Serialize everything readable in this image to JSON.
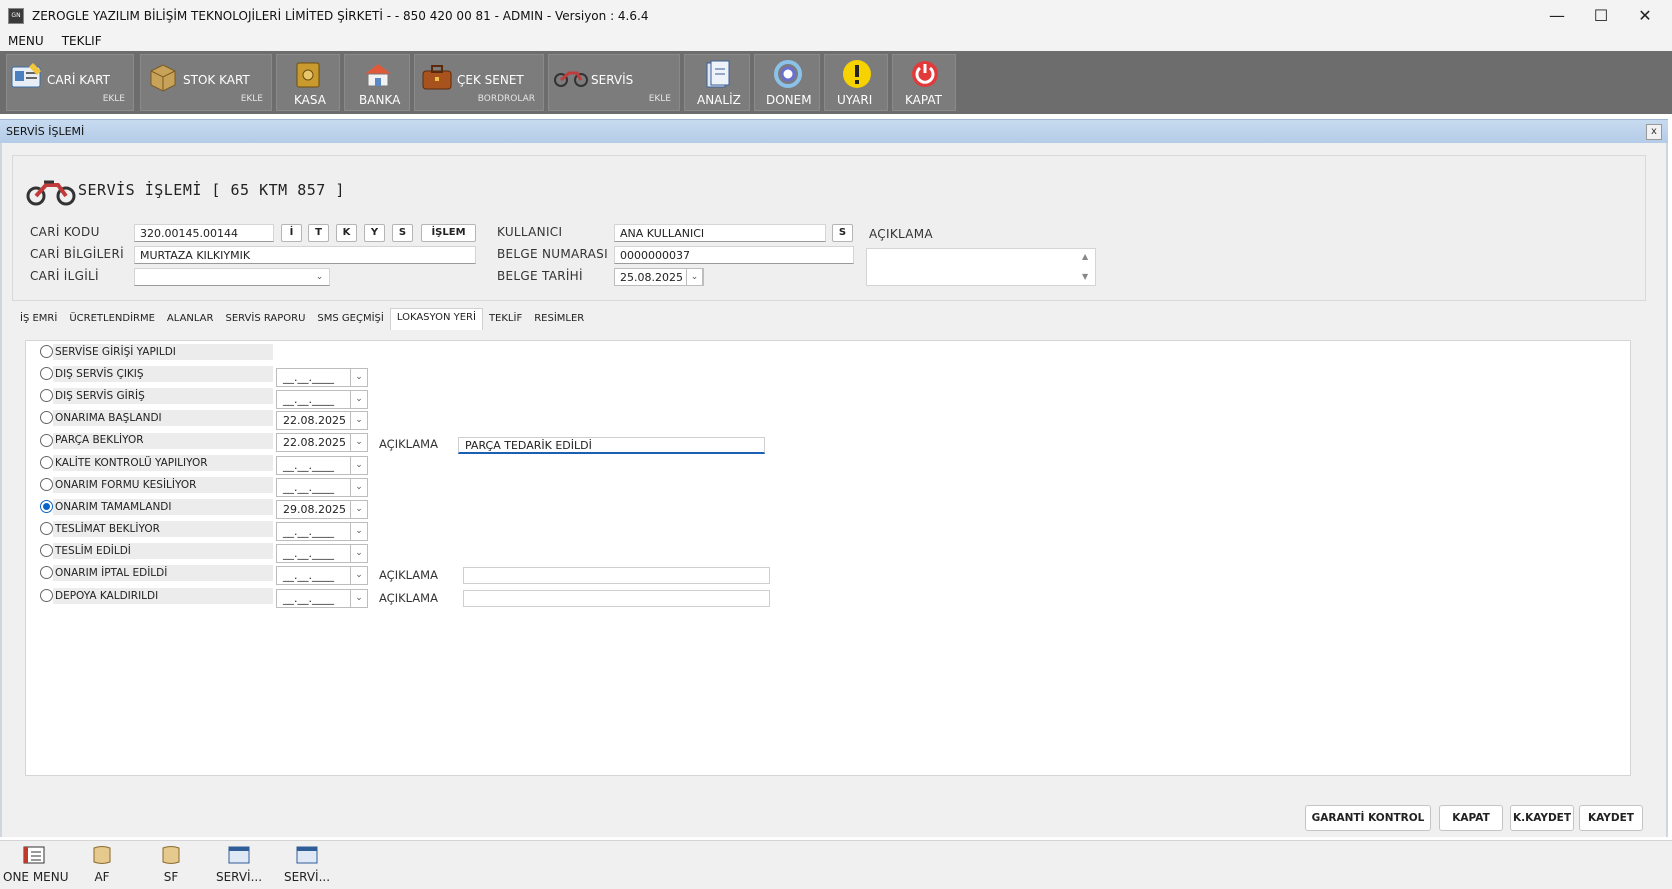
{
  "window": {
    "title": "ZEROGLE YAZILIM BİLİŞİM TEKNOLOJİLERİ LİMİTED ŞİRKETİ -  - 850 420 00 81 - ADMIN -  Versiyon : 4.6.4",
    "minimize": "—",
    "maximize": "☐",
    "close": "✕"
  },
  "menu": [
    "MENU",
    "TEKLIF"
  ],
  "toolbar": {
    "cari_kart": "CARİ KART",
    "cari_kart_sub": "EKLE",
    "stok_kart": "STOK KART",
    "stok_kart_sub": "EKLE",
    "kasa": "KASA",
    "banka": "BANKA",
    "cek_senet": "ÇEK SENET",
    "cek_senet_sub": "BORDROLAR",
    "servis": "SERVİS",
    "servis_sub": "EKLE",
    "analiz": "ANALİZ",
    "donem": "DONEM",
    "uyari": "UYARI",
    "kapat": "KAPAT"
  },
  "dialog": {
    "title": "SERVİS İŞLEMİ",
    "close": "x",
    "heading": "SERVİS İŞLEMİ [ 65 KTM 857 ]"
  },
  "form": {
    "cari_kodu_label": "CARİ KODU",
    "cari_kodu": "320.00145.00144",
    "btn_i": "İ",
    "btn_t": "T",
    "btn_k": "K",
    "btn_y": "Y",
    "btn_s": "S",
    "btn_islem": "İŞLEM",
    "cari_bilgileri_label": "CARİ BİLGİLERİ",
    "cari_bilgileri": "MURTAZA KILKIYMIK",
    "cari_ilgili_label": "CARİ İLGİLİ",
    "cari_ilgili": "",
    "kullanici_label": "KULLANICI",
    "kullanici": "ANA KULLANICI",
    "kullanici_btn": "S",
    "belge_no_label": "BELGE NUMARASI",
    "belge_no": "0000000037",
    "belge_tarihi_label": "BELGE TARİHİ",
    "belge_tarihi": "25.08.2025",
    "aciklama_label": "AÇIKLAMA",
    "aciklama": ""
  },
  "tabs": [
    "İŞ EMRİ",
    "ÜCRETLENDİRME",
    "ALANLAR",
    "SERVİS RAPORU",
    "SMS GEÇMİŞİ",
    "LOKASYON YERİ",
    "TEKLİF",
    "RESİMLER"
  ],
  "active_tab": "LOKASYON YERİ",
  "locations": [
    {
      "label": "SERVİSE GİRİŞİ YAPILDI",
      "date": null,
      "checked": false
    },
    {
      "label": "DIŞ SERVİS ÇIKIŞ",
      "date": "__.__.____",
      "checked": false
    },
    {
      "label": "DIŞ SERVİS GİRİŞ",
      "date": "__.__.____",
      "checked": false
    },
    {
      "label": "ONARIMA BAŞLANDI",
      "date": "22.08.2025",
      "checked": false
    },
    {
      "label": "PARÇA BEKLİYOR",
      "date": "22.08.2025",
      "checked": false
    },
    {
      "label": "KALİTE KONTROLÜ YAPILIYOR",
      "date": "__.__.____",
      "checked": false
    },
    {
      "label": "ONARIM FORMU KESİLİYOR",
      "date": "__.__.____",
      "checked": false
    },
    {
      "label": "ONARIM TAMAMLANDI",
      "date": "29.08.2025",
      "checked": true
    },
    {
      "label": "TESLİMAT BEKLİYOR",
      "date": "__.__.____",
      "checked": false
    },
    {
      "label": "TESLİM EDİLDİ",
      "date": "__.__.____",
      "checked": false
    },
    {
      "label": "ONARIM İPTAL EDİLDİ",
      "date": "__.__.____",
      "checked": false
    },
    {
      "label": "DEPOYA KALDIRILDI",
      "date": "__.__.____",
      "checked": false
    }
  ],
  "notes": {
    "label": "AÇIKLAMA",
    "parca": "PARÇA TEDARİK EDİLDİ",
    "iptal": "",
    "depo": ""
  },
  "buttons": {
    "garanti": "GARANTİ KONTROL",
    "kapat": "KAPAT",
    "kkaydet": "K.KAYDET",
    "kaydet": "KAYDET"
  },
  "taskbar": [
    "ONE MENU",
    "AF",
    "SF",
    "SERVİ...",
    "SERVİ..."
  ],
  "colors": {
    "toolbar_bg": "#6d6d6d",
    "radio_selected": "#0a64c8",
    "dialog_title": "#b4cce8"
  }
}
